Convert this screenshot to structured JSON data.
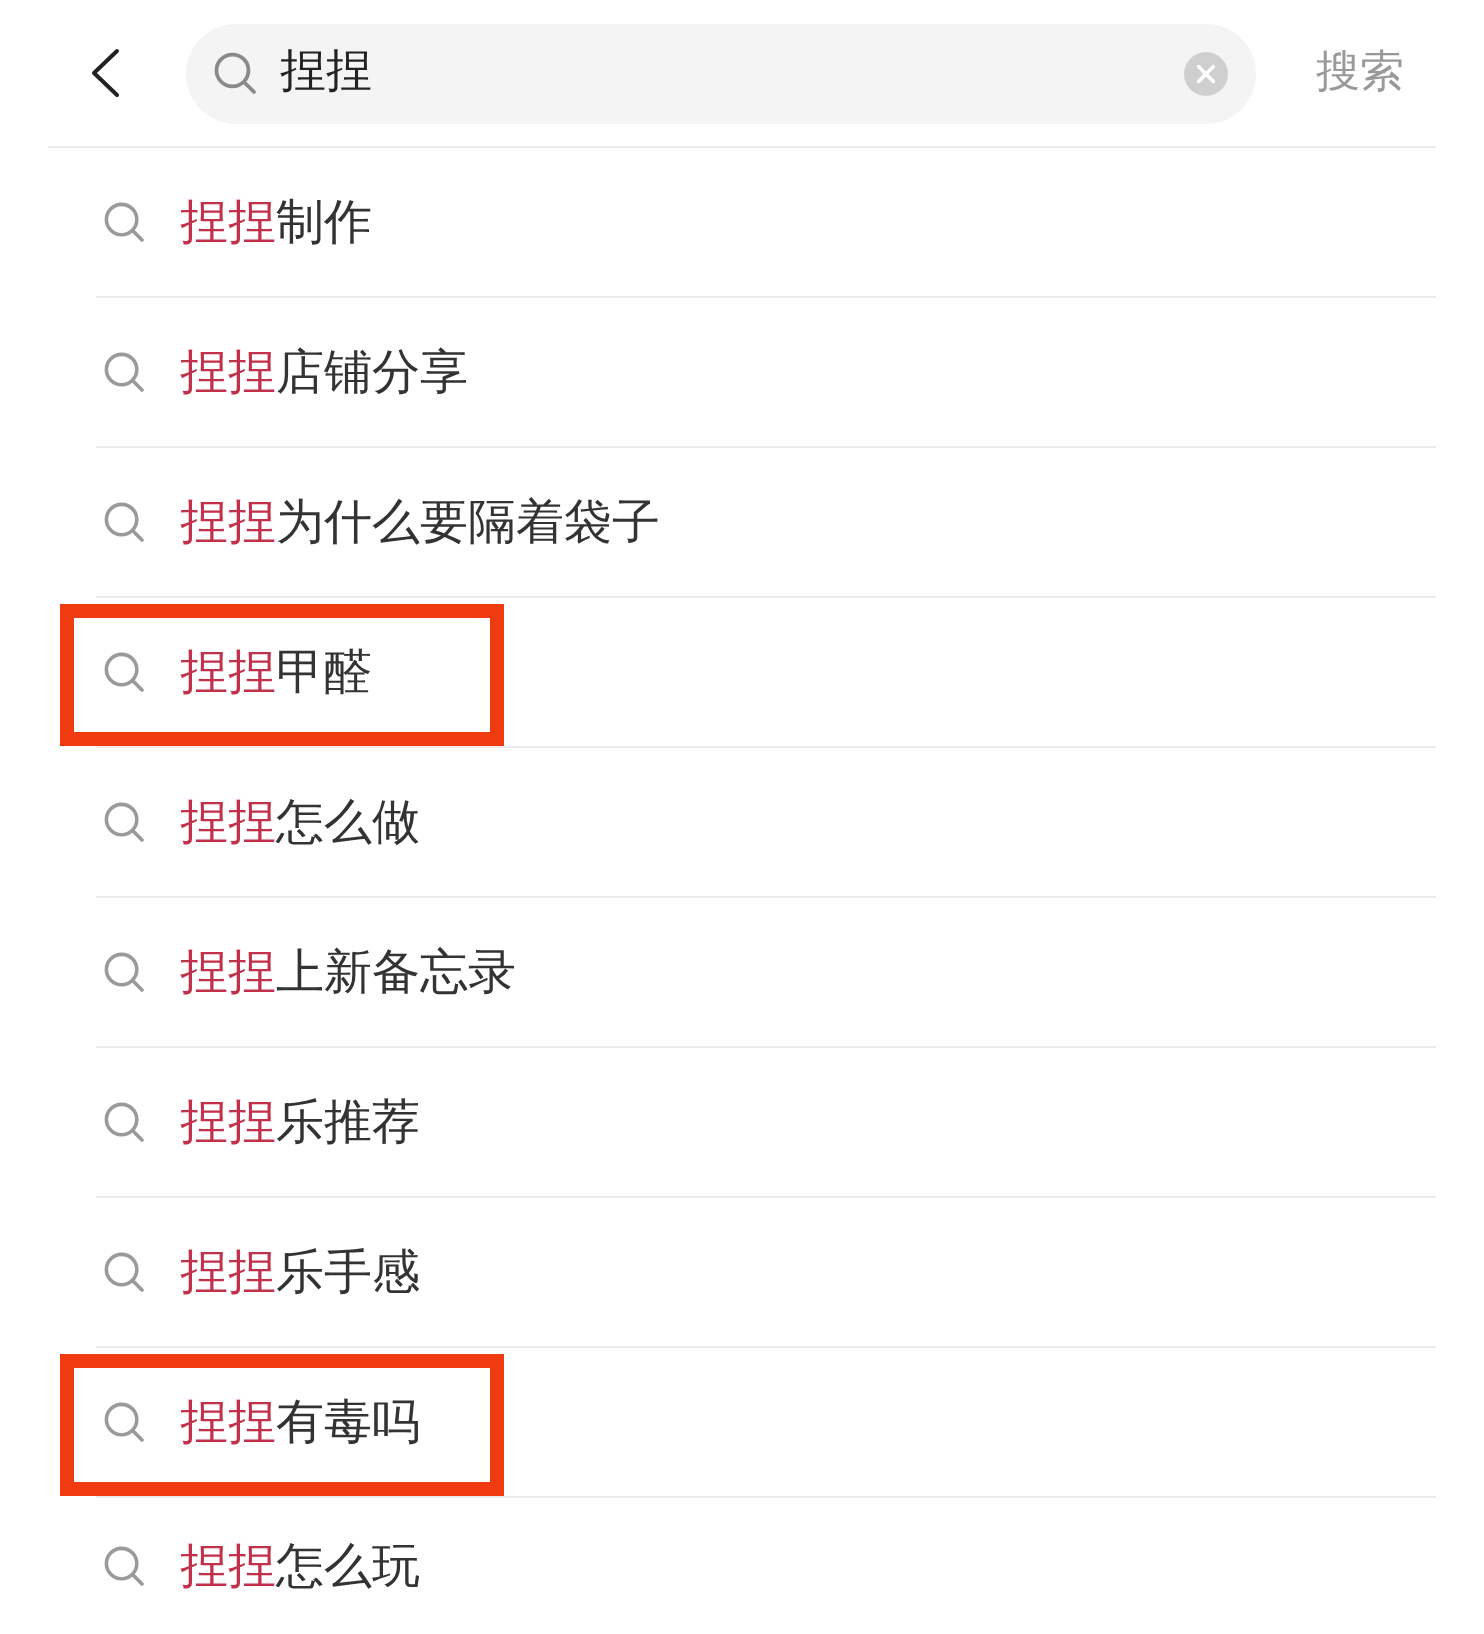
{
  "search": {
    "value": "捏捏",
    "action": "搜索"
  },
  "suggestions": [
    {
      "match": "捏捏",
      "rest": "制作",
      "framed": false
    },
    {
      "match": "捏捏",
      "rest": "店铺分享",
      "framed": false
    },
    {
      "match": "捏捏",
      "rest": "为什么要隔着袋子",
      "framed": false
    },
    {
      "match": "捏捏",
      "rest": "甲醛",
      "framed": true
    },
    {
      "match": "捏捏",
      "rest": "怎么做",
      "framed": false
    },
    {
      "match": "捏捏",
      "rest": "上新备忘录",
      "framed": false
    },
    {
      "match": "捏捏",
      "rest": "乐推荐",
      "framed": false
    },
    {
      "match": "捏捏",
      "rest": "乐手感",
      "framed": false
    },
    {
      "match": "捏捏",
      "rest": "有毒吗",
      "framed": true
    },
    {
      "match": "捏捏",
      "rest": "怎么玩",
      "framed": false
    }
  ]
}
